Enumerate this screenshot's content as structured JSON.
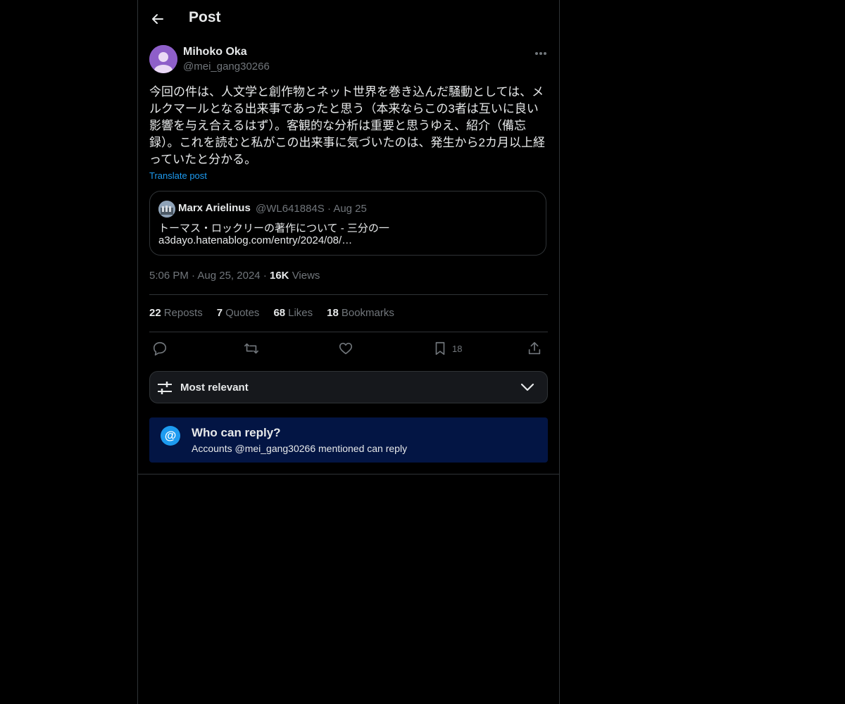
{
  "header": {
    "title": "Post",
    "back_icon": "arrow-left-icon"
  },
  "post": {
    "author_name": "Mihoko Oka",
    "author_handle": "@mei_gang30266",
    "text": "今回の件は、人文学と創作物とネット世界を巻き込んだ騒動としては、メルクマールとなる出来事であったと思う（本来ならこの3者は互いに良い影響を与え合えるはず）。客観的な分析は重要と思うゆえ、紹介（備忘録）。これを読むと私がこの出来事に気づいたのは、発生から2カ月以上経っていたと分かる。",
    "translate_label": "Translate post",
    "time": "5:06 PM",
    "date": "Aug 25, 2024",
    "views_count": "16K",
    "views_label": "Views"
  },
  "quote": {
    "name": "Marx Arielinus",
    "handle": "@WL641884S",
    "date": "Aug 25",
    "line1": "トーマス・ロックリーの著作について - 三分の一",
    "line2": "a3dayo.hatenablog.com/entry/2024/08/…"
  },
  "stats": {
    "reposts_count": "22",
    "reposts_label": "Reposts",
    "quotes_count": "7",
    "quotes_label": "Quotes",
    "likes_count": "68",
    "likes_label": "Likes",
    "bookmarks_count": "18",
    "bookmarks_label": "Bookmarks"
  },
  "actions": {
    "reply_icon": "reply-icon",
    "repost_icon": "repost-icon",
    "like_icon": "heart-icon",
    "bookmark_icon": "bookmark-icon",
    "bookmark_count": "18",
    "share_icon": "share-icon"
  },
  "sort": {
    "label": "Most relevant"
  },
  "reply_restriction": {
    "title": "Who can reply?",
    "subtitle": "Accounts @mei_gang30266 mentioned can reply",
    "icon_glyph": "@"
  },
  "colors": {
    "background": "#000000",
    "text": "#e7e9ea",
    "muted": "#71767b",
    "accent": "#1d9bf0",
    "border": "#2f3336",
    "reply_box": "#031544",
    "avatar": "#8e5fc9"
  }
}
